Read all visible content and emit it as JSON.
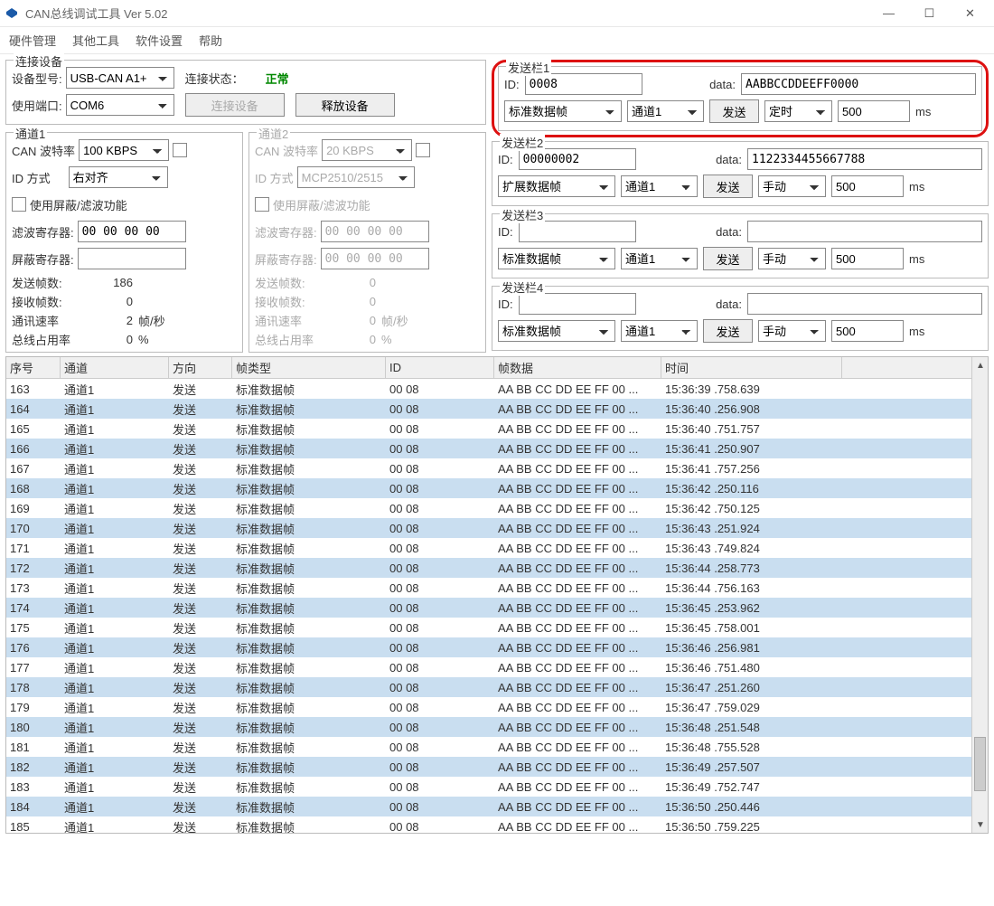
{
  "window": {
    "title": "CAN总线调试工具 Ver 5.02"
  },
  "menu": {
    "hardware": "硬件管理",
    "other": "其他工具",
    "software": "软件设置",
    "help": "帮助"
  },
  "connect": {
    "legend": "连接设备",
    "model_label": "设备型号:",
    "model_value": "USB-CAN A1+",
    "status_label": "连接状态：",
    "status_value": "正常",
    "port_label": "使用端口:",
    "port_value": "COM6",
    "connect_btn": "连接设备",
    "release_btn": "释放设备"
  },
  "ch1": {
    "legend": "通道1",
    "baud_label": "CAN 波特率",
    "baud_value": "100 KBPS",
    "idmode_label": "ID 方式",
    "idmode_value": "右对齐",
    "filter_chk_label": "使用屏蔽/滤波功能",
    "filter_reg_label": "滤波寄存器:",
    "filter_reg_value": "00 00 00 00",
    "mask_reg_label": "屏蔽寄存器:",
    "mask_reg_value": "",
    "tx_label": "发送帧数:",
    "tx_value": "186",
    "rx_label": "接收帧数:",
    "rx_value": "0",
    "rate_label": "通讯速率",
    "rate_value": "2",
    "rate_unit": "帧/秒",
    "bus_label": "总线占用率",
    "bus_value": "0",
    "bus_unit": "%"
  },
  "ch2": {
    "legend": "通道2",
    "baud_label": "CAN 波特率",
    "baud_value": "20 KBPS",
    "idmode_label": "ID 方式",
    "idmode_value": "MCP2510/2515",
    "filter_chk_label": "使用屏蔽/滤波功能",
    "filter_reg_label": "滤波寄存器:",
    "filter_reg_value": "00 00 00 00",
    "mask_reg_label": "屏蔽寄存器:",
    "mask_reg_value": "00 00 00 00",
    "tx_label": "发送帧数:",
    "tx_value": "0",
    "rx_label": "接收帧数:",
    "rx_value": "0",
    "rate_label": "通讯速率",
    "rate_value": "0",
    "rate_unit": "帧/秒",
    "bus_label": "总线占用率",
    "bus_value": "0",
    "bus_unit": "%"
  },
  "send_labels": {
    "id": "ID:",
    "data": "data:",
    "send": "发送",
    "ms": "ms",
    "channel": "通道1"
  },
  "send1": {
    "legend": "发送栏1",
    "id": "0008",
    "data": "AABBCCDDEEFF0000",
    "frame": "标准数据帧",
    "mode": "定时",
    "interval": "500"
  },
  "send2": {
    "legend": "发送栏2",
    "id": "00000002",
    "data": "1122334455667788",
    "frame": "扩展数据帧",
    "mode": "手动",
    "interval": "500"
  },
  "send3": {
    "legend": "发送栏3",
    "id": "",
    "data": "",
    "frame": "标准数据帧",
    "mode": "手动",
    "interval": "500"
  },
  "send4": {
    "legend": "发送栏4",
    "id": "",
    "data": "",
    "frame": "标准数据帧",
    "mode": "手动",
    "interval": "500"
  },
  "table": {
    "headers": {
      "seq": "序号",
      "ch": "通道",
      "dir": "方向",
      "type": "帧类型",
      "id": "ID",
      "data": "帧数据",
      "time": "时间"
    },
    "rows": [
      {
        "seq": "163",
        "ch": "通道1",
        "dir": "发送",
        "type": "标准数据帧",
        "id": "00 08",
        "data": "AA BB CC DD EE FF 00 ...",
        "time": "15:36:39 .758.639"
      },
      {
        "seq": "164",
        "ch": "通道1",
        "dir": "发送",
        "type": "标准数据帧",
        "id": "00 08",
        "data": "AA BB CC DD EE FF 00 ...",
        "time": "15:36:40 .256.908"
      },
      {
        "seq": "165",
        "ch": "通道1",
        "dir": "发送",
        "type": "标准数据帧",
        "id": "00 08",
        "data": "AA BB CC DD EE FF 00 ...",
        "time": "15:36:40 .751.757"
      },
      {
        "seq": "166",
        "ch": "通道1",
        "dir": "发送",
        "type": "标准数据帧",
        "id": "00 08",
        "data": "AA BB CC DD EE FF 00 ...",
        "time": "15:36:41 .250.907"
      },
      {
        "seq": "167",
        "ch": "通道1",
        "dir": "发送",
        "type": "标准数据帧",
        "id": "00 08",
        "data": "AA BB CC DD EE FF 00 ...",
        "time": "15:36:41 .757.256"
      },
      {
        "seq": "168",
        "ch": "通道1",
        "dir": "发送",
        "type": "标准数据帧",
        "id": "00 08",
        "data": "AA BB CC DD EE FF 00 ...",
        "time": "15:36:42 .250.116"
      },
      {
        "seq": "169",
        "ch": "通道1",
        "dir": "发送",
        "type": "标准数据帧",
        "id": "00 08",
        "data": "AA BB CC DD EE FF 00 ...",
        "time": "15:36:42 .750.125"
      },
      {
        "seq": "170",
        "ch": "通道1",
        "dir": "发送",
        "type": "标准数据帧",
        "id": "00 08",
        "data": "AA BB CC DD EE FF 00 ...",
        "time": "15:36:43 .251.924"
      },
      {
        "seq": "171",
        "ch": "通道1",
        "dir": "发送",
        "type": "标准数据帧",
        "id": "00 08",
        "data": "AA BB CC DD EE FF 00 ...",
        "time": "15:36:43 .749.824"
      },
      {
        "seq": "172",
        "ch": "通道1",
        "dir": "发送",
        "type": "标准数据帧",
        "id": "00 08",
        "data": "AA BB CC DD EE FF 00 ...",
        "time": "15:36:44 .258.773"
      },
      {
        "seq": "173",
        "ch": "通道1",
        "dir": "发送",
        "type": "标准数据帧",
        "id": "00 08",
        "data": "AA BB CC DD EE FF 00 ...",
        "time": "15:36:44 .756.163"
      },
      {
        "seq": "174",
        "ch": "通道1",
        "dir": "发送",
        "type": "标准数据帧",
        "id": "00 08",
        "data": "AA BB CC DD EE FF 00 ...",
        "time": "15:36:45 .253.962"
      },
      {
        "seq": "175",
        "ch": "通道1",
        "dir": "发送",
        "type": "标准数据帧",
        "id": "00 08",
        "data": "AA BB CC DD EE FF 00 ...",
        "time": "15:36:45 .758.001"
      },
      {
        "seq": "176",
        "ch": "通道1",
        "dir": "发送",
        "type": "标准数据帧",
        "id": "00 08",
        "data": "AA BB CC DD EE FF 00 ...",
        "time": "15:36:46 .256.981"
      },
      {
        "seq": "177",
        "ch": "通道1",
        "dir": "发送",
        "type": "标准数据帧",
        "id": "00 08",
        "data": "AA BB CC DD EE FF 00 ...",
        "time": "15:36:46 .751.480"
      },
      {
        "seq": "178",
        "ch": "通道1",
        "dir": "发送",
        "type": "标准数据帧",
        "id": "00 08",
        "data": "AA BB CC DD EE FF 00 ...",
        "time": "15:36:47 .251.260"
      },
      {
        "seq": "179",
        "ch": "通道1",
        "dir": "发送",
        "type": "标准数据帧",
        "id": "00 08",
        "data": "AA BB CC DD EE FF 00 ...",
        "time": "15:36:47 .759.029"
      },
      {
        "seq": "180",
        "ch": "通道1",
        "dir": "发送",
        "type": "标准数据帧",
        "id": "00 08",
        "data": "AA BB CC DD EE FF 00 ...",
        "time": "15:36:48 .251.548"
      },
      {
        "seq": "181",
        "ch": "通道1",
        "dir": "发送",
        "type": "标准数据帧",
        "id": "00 08",
        "data": "AA BB CC DD EE FF 00 ...",
        "time": "15:36:48 .755.528"
      },
      {
        "seq": "182",
        "ch": "通道1",
        "dir": "发送",
        "type": "标准数据帧",
        "id": "00 08",
        "data": "AA BB CC DD EE FF 00 ...",
        "time": "15:36:49 .257.507"
      },
      {
        "seq": "183",
        "ch": "通道1",
        "dir": "发送",
        "type": "标准数据帧",
        "id": "00 08",
        "data": "AA BB CC DD EE FF 00 ...",
        "time": "15:36:49 .752.747"
      },
      {
        "seq": "184",
        "ch": "通道1",
        "dir": "发送",
        "type": "标准数据帧",
        "id": "00 08",
        "data": "AA BB CC DD EE FF 00 ...",
        "time": "15:36:50 .250.446"
      },
      {
        "seq": "185",
        "ch": "通道1",
        "dir": "发送",
        "type": "标准数据帧",
        "id": "00 08",
        "data": "AA BB CC DD EE FF 00 ...",
        "time": "15:36:50 .759.225"
      }
    ]
  }
}
